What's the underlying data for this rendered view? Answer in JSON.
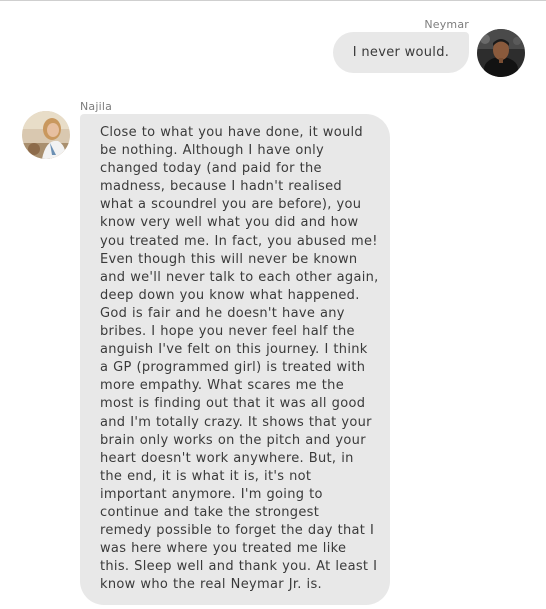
{
  "conversation": {
    "messages": [
      {
        "sender": "Neymar",
        "direction": "outgoing",
        "lines": [
          "I never would."
        ]
      },
      {
        "sender": "Najila",
        "direction": "incoming",
        "lines": [
          "Close to what you have done, it would",
          "be nothing. Although I have only",
          "changed today (and paid for the",
          "madness, because I hadn't realised",
          "what a scoundrel you are before), you",
          "know very well what you did and how",
          "you treated me. In fact, you abused me!",
          "Even though this will never be known",
          "and we'll never talk to each other again,",
          "deep down you know what happened.",
          "God is fair and he doesn't have any",
          "bribes. I hope you never feel half the",
          "anguish I've felt on this journey. I think",
          "a GP (programmed girl) is treated with",
          "more empathy. What scares me the",
          "most is finding out that it was all good",
          "and I'm totally crazy. It shows that your",
          "brain only works on the pitch and your",
          "heart doesn't work anywhere. But, in",
          "the end, it is what it is, it's not",
          "important anymore. I'm going to",
          "continue and take the strongest",
          "remedy possible to forget the day that I",
          "was here where you treated me like",
          "this. Sleep well and thank you. At least I",
          "know who the real Neymar Jr. is."
        ]
      }
    ]
  },
  "colors": {
    "bubble_background": "#e8e8e8",
    "message_text": "#3a3a3a",
    "sender_name_text": "#7d7d7d",
    "page_background": "#ffffff"
  },
  "icons": {
    "outgoing_avatar": "avatar-photo",
    "incoming_avatar": "avatar-photo"
  }
}
